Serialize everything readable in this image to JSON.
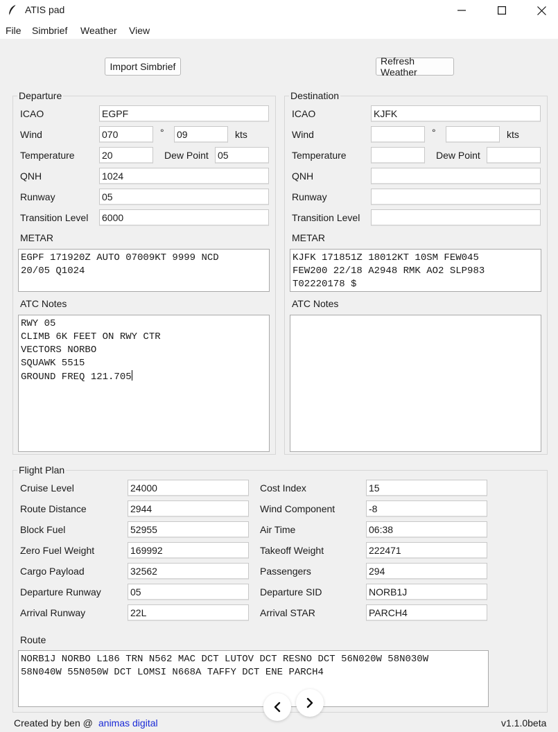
{
  "window": {
    "title": "ATIS pad"
  },
  "menu": [
    "File",
    "Simbrief",
    "Weather",
    "View"
  ],
  "buttons": {
    "import_simbrief": "Import Simbrief",
    "refresh_weather": "Refresh Weather"
  },
  "departure": {
    "title": "Departure",
    "labels": {
      "icao": "ICAO",
      "wind": "Wind",
      "deg": "°",
      "kts": "kts",
      "temperature": "Temperature",
      "dew_point": "Dew Point",
      "qnh": "QNH",
      "runway": "Runway",
      "transition_level": "Transition Level",
      "metar": "METAR",
      "atc_notes": "ATC Notes"
    },
    "values": {
      "icao": "EGPF",
      "wind_dir": "070",
      "wind_speed": "09",
      "temperature": "20",
      "dew_point": "05",
      "qnh": "1024",
      "runway": "05",
      "transition_level": "6000"
    },
    "metar": "EGPF 171920Z AUTO 07009KT 9999 NCD\n20/05 Q1024",
    "atc_notes": "RWY 05\nCLIMB 6K FEET ON RWY CTR\nVECTORS NORBO\nSQUAWK 5515\nGROUND FREQ 121.705"
  },
  "destination": {
    "title": "Destination",
    "labels": {
      "icao": "ICAO",
      "wind": "Wind",
      "deg": "°",
      "kts": "kts",
      "temperature": "Temperature",
      "dew_point": "Dew Point",
      "qnh": "QNH",
      "runway": "Runway",
      "transition_level": "Transition Level",
      "metar": "METAR",
      "atc_notes": "ATC Notes"
    },
    "values": {
      "icao": "KJFK",
      "wind_dir": "",
      "wind_speed": "",
      "temperature": "",
      "dew_point": "",
      "qnh": "",
      "runway": "",
      "transition_level": ""
    },
    "metar": "KJFK 171851Z 18012KT 10SM FEW045\nFEW200 22/18 A2948 RMK AO2 SLP983\nT02220178 $",
    "atc_notes": ""
  },
  "flight_plan": {
    "title": "Flight Plan",
    "rows": [
      {
        "left_label": "Cruise Level",
        "left_value": "24000",
        "right_label": "Cost Index",
        "right_value": "15"
      },
      {
        "left_label": "Route Distance",
        "left_value": "2944",
        "right_label": "Wind Component",
        "right_value": "-8"
      },
      {
        "left_label": "Block Fuel",
        "left_value": "52955",
        "right_label": "Air Time",
        "right_value": "06:38"
      },
      {
        "left_label": "Zero Fuel Weight",
        "left_value": "169992",
        "right_label": "Takeoff Weight",
        "right_value": "222471"
      },
      {
        "left_label": "Cargo Payload",
        "left_value": "32562",
        "right_label": "Passengers",
        "right_value": "294"
      },
      {
        "left_label": "Departure Runway",
        "left_value": "05",
        "right_label": "Departure SID",
        "right_value": "NORB1J"
      },
      {
        "left_label": "Arrival Runway",
        "left_value": "22L",
        "right_label": "Arrival STAR",
        "right_value": "PARCH4"
      }
    ],
    "route_label": "Route",
    "route": "NORB1J NORBO L186 TRN N562 MAC DCT LUTOV DCT RESNO DCT 56N020W 58N030W\n58N040W 55N050W DCT LOMSI N668A TAFFY DCT ENE PARCH4"
  },
  "footer": {
    "created_by": "Created by ben @",
    "link": "animas digital",
    "version": "v1.1.0beta"
  },
  "icons": {
    "app": "feather-icon",
    "minimize": "minimize-icon",
    "maximize": "maximize-icon",
    "close": "close-icon",
    "prev": "chevron-left-icon",
    "next": "chevron-right-icon"
  },
  "colors": {
    "link": "#1a2ad6",
    "background": "#f0f0f0"
  }
}
